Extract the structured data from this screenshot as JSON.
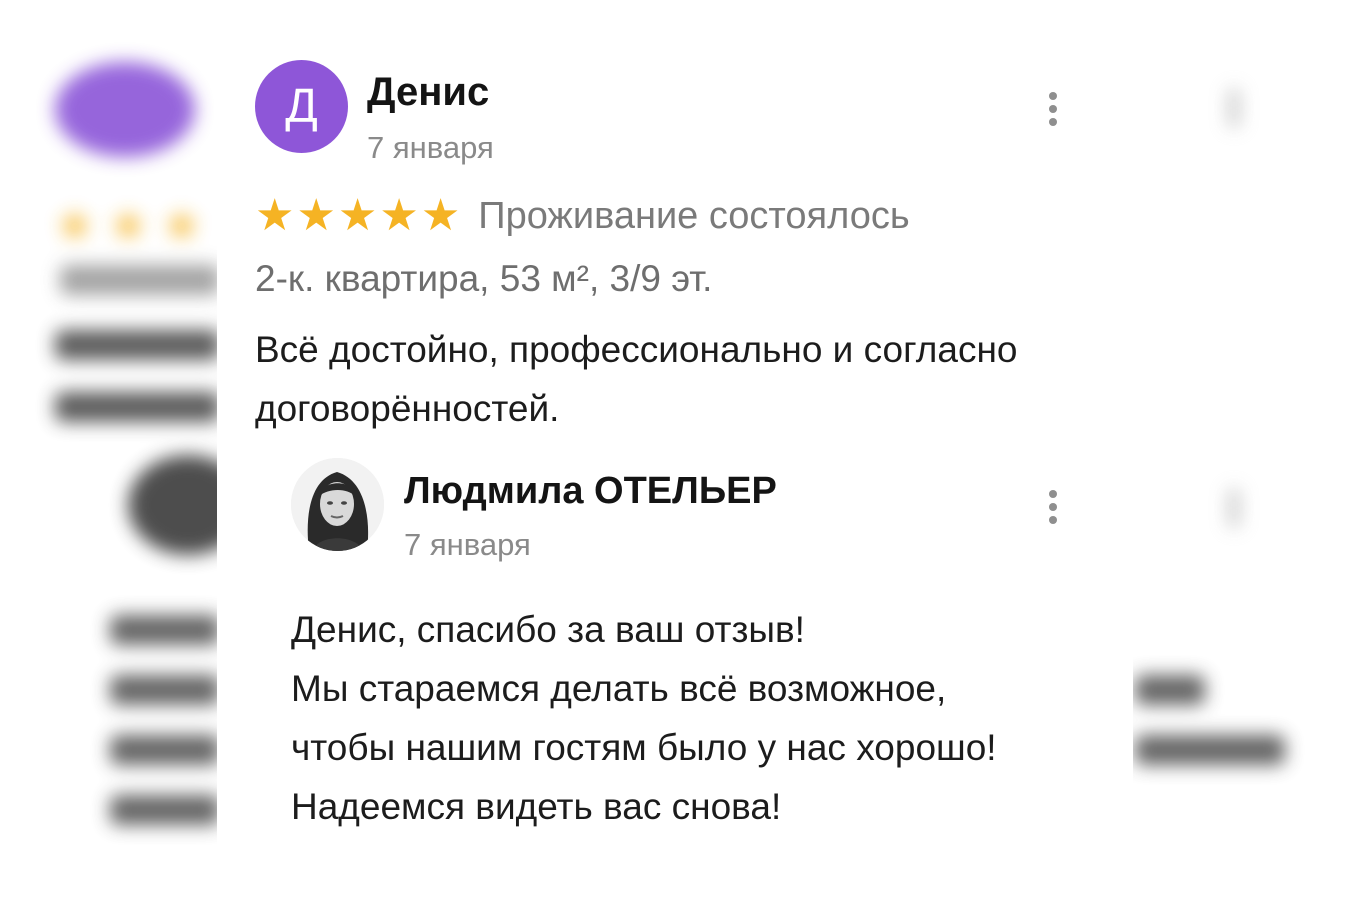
{
  "review": {
    "avatar_letter": "Д",
    "author": "Денис",
    "date": "7 января",
    "rating": 5,
    "rating_max": 5,
    "status": "Проживание состоялось",
    "apartment": "2-к. квартира, 53 м², 3/9 эт.",
    "text": "Всё достойно, профессионально и согласно договорённостей.",
    "avatar_color": "#8e56d8",
    "star_color": "#f5b324"
  },
  "reply": {
    "author": "Людмила ОТЕЛЬЕР",
    "date": "7 января",
    "lines": [
      "Денис, спасибо за ваш отзыв!",
      "Мы стараемся делать всё возможное,",
      "чтобы нашим гостям было у нас хорошо!",
      "Надеемся видеть вас снова!"
    ]
  },
  "icons": {
    "more": "more-vertical-icon",
    "star": "star-icon"
  }
}
